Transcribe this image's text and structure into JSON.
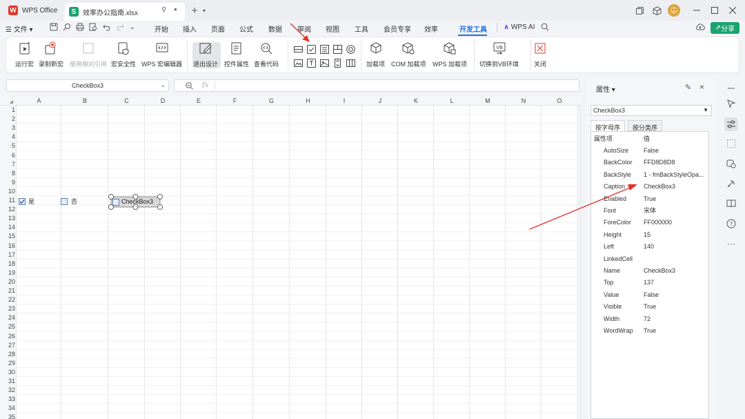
{
  "titlebar": {
    "home_tab": "WPS Office",
    "file_tab": "效率办公指南.xlsx",
    "new_tab_symbol": "+",
    "colors": {
      "wps_red": "#e0342b",
      "sheet_green": "#1aa36f"
    }
  },
  "menu": {
    "file": "文件",
    "items": [
      "开始",
      "插入",
      "页面",
      "公式",
      "数据",
      "审阅",
      "视图",
      "工具",
      "会员专享",
      "效率",
      "开发工具"
    ],
    "active": "开发工具",
    "wps_ai": "WPS AI",
    "share": "分享"
  },
  "ribbon": {
    "run_macro": "运行宏",
    "record_macro": "录制新宏",
    "relative_ref": "使用相对引用",
    "macro_security": "宏安全性",
    "vb_editor": "WPS 宏编辑器",
    "exit_design": "退出设计",
    "control_props": "控件属性",
    "view_code": "查看代码",
    "addins": "加载项",
    "com_addins": "COM 加载项",
    "wps_addins": "WPS 加载项",
    "switch_vb": "切换到VB环境",
    "close": "关闭"
  },
  "formula_bar": {
    "name_box": "CheckBox3",
    "fx": "fx"
  },
  "sheet": {
    "columns": [
      "A",
      "B",
      "C",
      "D",
      "E",
      "F",
      "G",
      "H",
      "I",
      "J",
      "K",
      "L",
      "M",
      "N",
      "O"
    ],
    "rows": [
      "1",
      "2",
      "3",
      "4",
      "5",
      "6",
      "7",
      "8",
      "9",
      "10",
      "11",
      "12",
      "13",
      "14",
      "15",
      "16",
      "17",
      "18",
      "19",
      "20",
      "21",
      "22",
      "23",
      "24",
      "25",
      "26",
      "27",
      "28",
      "29",
      "30",
      "31",
      "32",
      "33",
      "34",
      "35"
    ],
    "checkboxes": [
      {
        "label": "是",
        "checked": true
      },
      {
        "label": "否",
        "checked": false
      },
      {
        "label": "CheckBox3",
        "checked": false
      }
    ]
  },
  "properties": {
    "title": "属性",
    "object": "CheckBox3",
    "tab_alpha": "按字母序",
    "tab_category": "按分类序",
    "header_key": "属性项",
    "header_value": "值",
    "rows": [
      {
        "k": "AutoSize",
        "v": "False"
      },
      {
        "k": "BackColor",
        "v": "FFD8D8D8"
      },
      {
        "k": "BackStyle",
        "v": "1 - fmBackStyleOpa..."
      },
      {
        "k": "Caption",
        "v": "CheckBox3"
      },
      {
        "k": "Enabled",
        "v": "True"
      },
      {
        "k": "Font",
        "v": "宋体"
      },
      {
        "k": "ForeColor",
        "v": "FF000000"
      },
      {
        "k": "Height",
        "v": "15"
      },
      {
        "k": "Left",
        "v": "140"
      },
      {
        "k": "LinkedCell",
        "v": ""
      },
      {
        "k": "Name",
        "v": "CheckBox3"
      },
      {
        "k": "Top",
        "v": "137"
      },
      {
        "k": "Value",
        "v": "False"
      },
      {
        "k": "Visible",
        "v": "True"
      },
      {
        "k": "Width",
        "v": "72"
      },
      {
        "k": "WordWrap",
        "v": "True"
      }
    ]
  }
}
